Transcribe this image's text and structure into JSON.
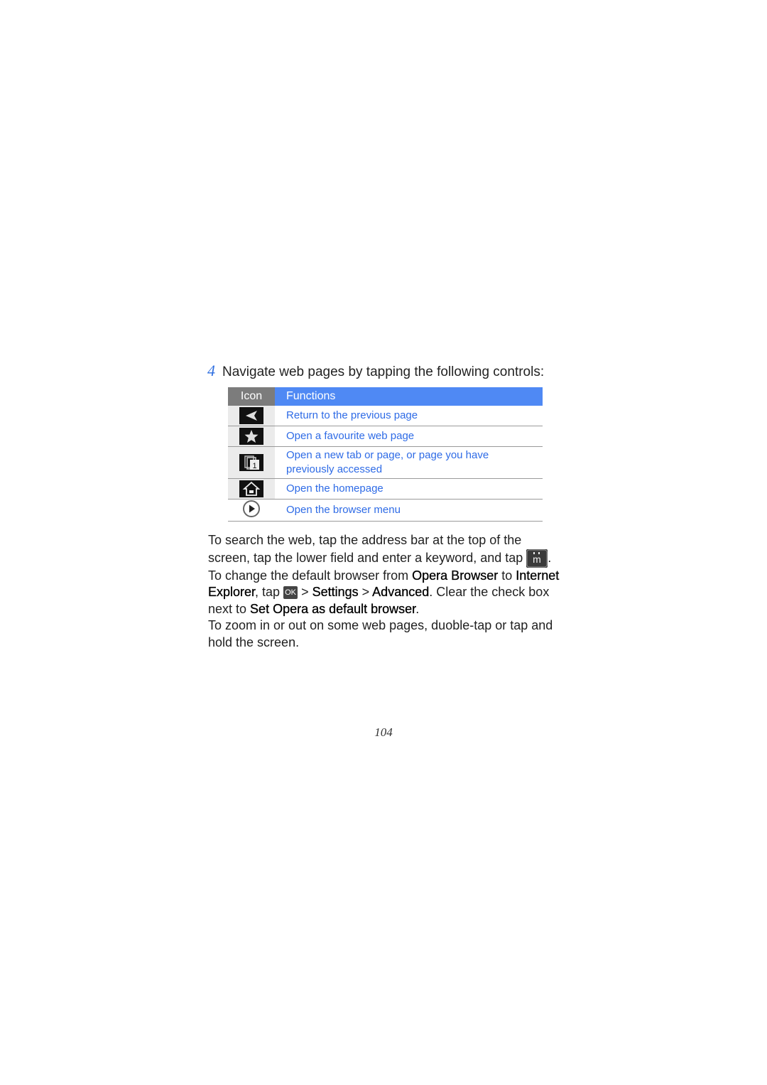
{
  "step": {
    "number": "4",
    "text": "Navigate web pages by tapping the following controls:"
  },
  "table": {
    "headers": {
      "icon": "Icon",
      "functions": "Functions"
    },
    "rows": [
      {
        "icon": "back-arrow-icon",
        "function": "Return to the previous page"
      },
      {
        "icon": "star-icon",
        "function": "Open a favourite web page"
      },
      {
        "icon": "tabs-icon",
        "function": "Open a new tab or page, or page you have previously accessed"
      },
      {
        "icon": "home-icon",
        "function": "Open the homepage"
      },
      {
        "icon": "play-menu-icon",
        "function": "Open the browser menu"
      }
    ]
  },
  "paragraph": {
    "p1_a": "To search the web, tap the address bar at the top of the screen, tap the lower field and enter a keyword, and tap ",
    "p1_icon": "search-go-icon",
    "p1_b": ".",
    "p2_a": "To change the default browser from ",
    "p2_opera": "Opera Browser",
    "p2_b": " to ",
    "p2_ie": "Internet Explorer",
    "p2_c": ", tap ",
    "p2_ok": "OK",
    "p2_d": " > ",
    "p2_settings": "Settings",
    "p2_e": " > ",
    "p2_adv": "Advanced",
    "p2_f": ". Clear the check box next to ",
    "p2_set": "Set Opera as default browser",
    "p2_g": ".",
    "p3": "To zoom in or out on some web pages, duoble-tap or tap and hold the screen."
  },
  "page_number": "104"
}
